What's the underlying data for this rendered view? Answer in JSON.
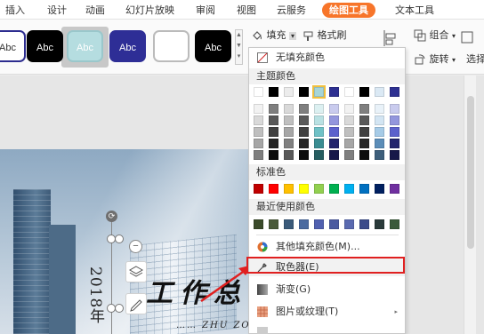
{
  "menubar": {
    "tabs": [
      "插入",
      "设计",
      "动画",
      "幻灯片放映",
      "审阅",
      "视图",
      "云服务",
      "绘图工具",
      "文本工具"
    ],
    "active_tab": "绘图工具",
    "accent": "#f7752a"
  },
  "ribbon": {
    "style_swatches": [
      {
        "label": "Abc",
        "bg": "#ffffff",
        "fg": "#333333",
        "border": "#2d2d8f"
      },
      {
        "label": "Abc",
        "bg": "#000000",
        "fg": "#ffffff",
        "border": "#000000"
      },
      {
        "label": "Abc",
        "bg": "#b5dde0",
        "fg": "#ffffff",
        "border": "#9ac7cb"
      },
      {
        "label": "Abc",
        "bg": "#2e2e96",
        "fg": "#ffffff",
        "border": "#2e2e96"
      },
      {
        "label": "",
        "bg": "#ffffff",
        "fg": "#333333",
        "border": "#bbbbbb"
      },
      {
        "label": "Abc",
        "bg": "#000000",
        "fg": "#ffffff",
        "border": "#000000"
      }
    ],
    "fill_label": "填充",
    "format_brush_label": "格式刷",
    "group_label": "组合",
    "rotate_label": "旋转",
    "select_label": "选择"
  },
  "slide": {
    "year_text": "2018年",
    "title_text": "工作总",
    "subtitle_text": "……  ZHU ZONG"
  },
  "fill_menu": {
    "no_fill_label": "无填充颜色",
    "theme_colors_label": "主题颜色",
    "theme_top_row": [
      "#ffffff",
      "#000000",
      "#ececec",
      "#000000",
      "#a6d5d8",
      "#2e3192",
      "#ffffff",
      "#000000",
      "#dbe9f4",
      "#2e3192"
    ],
    "theme_shades": [
      [
        "#f2f2f2",
        "#7f7f7f",
        "#d9d9d9",
        "#7f7f7f",
        "#dcf0f1",
        "#c9cbee",
        "#f2f2f2",
        "#7f7f7f",
        "#e9f2f9",
        "#c9cbee"
      ],
      [
        "#d9d9d9",
        "#595959",
        "#bfbfbf",
        "#595959",
        "#b9e1e3",
        "#9396dd",
        "#d9d9d9",
        "#595959",
        "#d3e5f3",
        "#9396dd"
      ],
      [
        "#bfbfbf",
        "#404040",
        "#a6a6a6",
        "#404040",
        "#6fc1c6",
        "#5c61cc",
        "#bfbfbf",
        "#404040",
        "#a6cbe7",
        "#5c61cc"
      ],
      [
        "#a6a6a6",
        "#262626",
        "#808080",
        "#262626",
        "#3a8d92",
        "#22246d",
        "#a6a6a6",
        "#262626",
        "#5b8db8",
        "#22246d"
      ],
      [
        "#7f7f7f",
        "#0d0d0d",
        "#595959",
        "#0d0d0d",
        "#265e61",
        "#171849",
        "#7f7f7f",
        "#0d0d0d",
        "#3d5e7b",
        "#171849"
      ]
    ],
    "standard_colors_label": "标准色",
    "standard_colors": [
      "#c00000",
      "#ff0000",
      "#ffc000",
      "#ffff00",
      "#92d050",
      "#00b050",
      "#00b0f0",
      "#0070c0",
      "#002060",
      "#7030a0"
    ],
    "recent_colors_label": "最近使用颜色",
    "recent_colors": [
      "#3a4a2a",
      "#4a5a3a",
      "#3a5a7a",
      "#4a6aa0",
      "#5060b0",
      "#4a5aa0",
      "#5a6ab0",
      "#3a4a8a",
      "#2a3a3a",
      "#3a5a3a"
    ],
    "more_fill_label": "其他填充颜色(M)...",
    "eyedropper_label": "取色器(E)",
    "gradient_label": "渐变(G)",
    "picture_texture_label": "图片或纹理(T)"
  }
}
